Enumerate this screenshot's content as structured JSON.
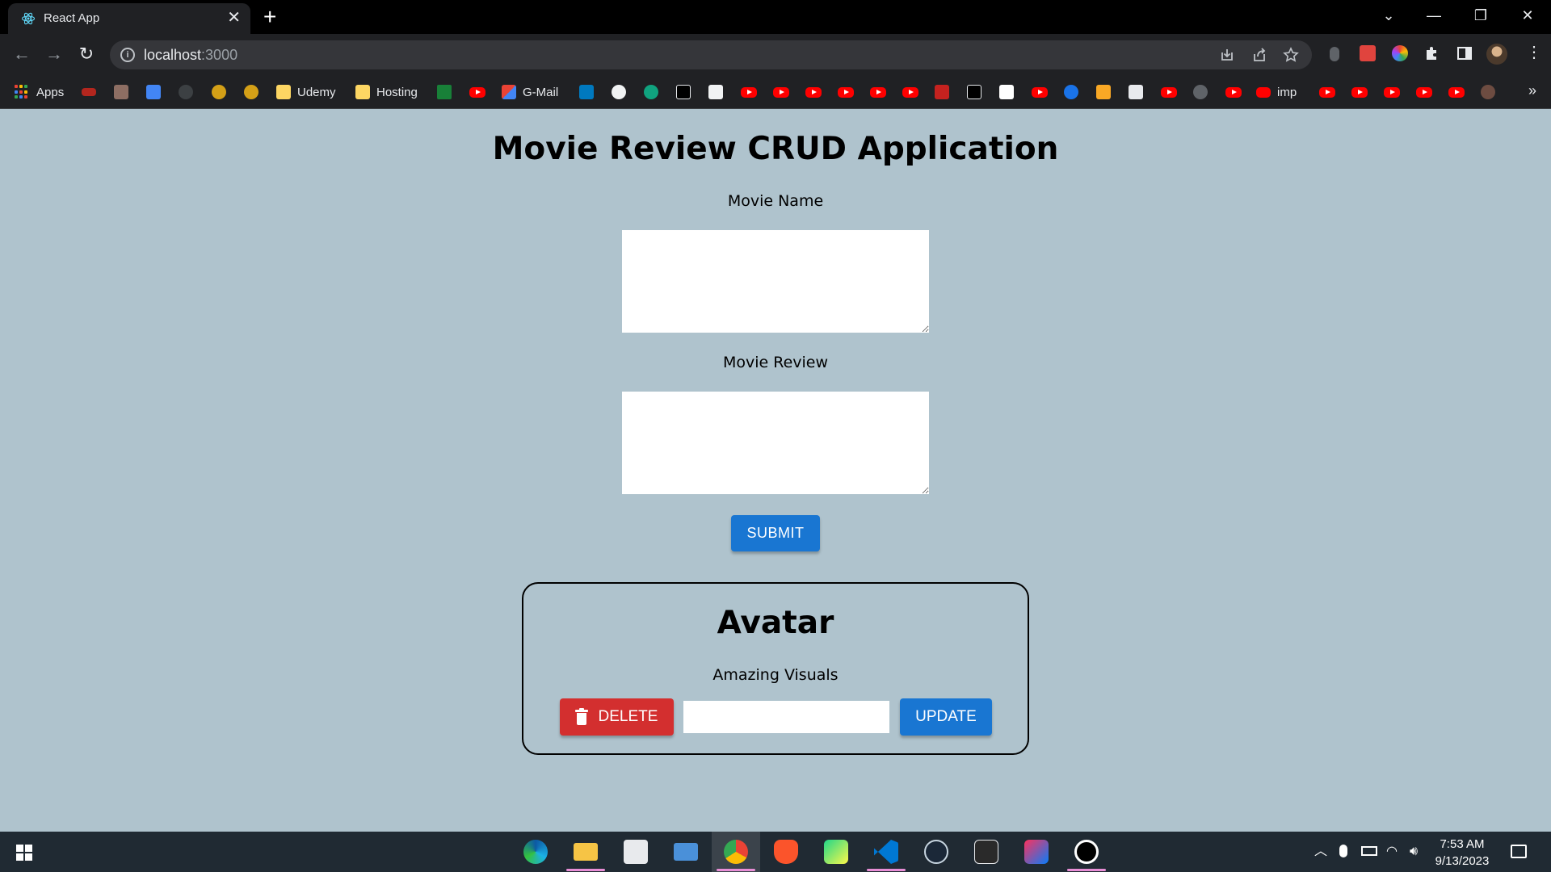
{
  "browser": {
    "tab_title": "React App",
    "tab_close": "✕",
    "new_tab": "+",
    "url_host": "localhost",
    "url_port": ":3000",
    "window_controls": {
      "tab_search": "⌄",
      "minimize": "—",
      "restore": "❐",
      "close": "✕"
    },
    "nav": {
      "back": "←",
      "forward": "→",
      "reload": "↻"
    }
  },
  "bookmarks": {
    "apps": "Apps",
    "udemy": "Udemy",
    "hosting": "Hosting",
    "gmail": "G-Mail",
    "imp": "imp",
    "more": "»"
  },
  "app": {
    "title": "Movie Review CRUD Application",
    "movie_name_label": "Movie Name",
    "movie_review_label": "Movie Review",
    "movie_name_value": "",
    "movie_review_value": "",
    "submit_label": "SUBMIT"
  },
  "reviews": [
    {
      "movie_name": "Avatar",
      "review": "Amazing Visuals",
      "delete_label": "DELETE",
      "update_label": "UPDATE",
      "update_value": ""
    }
  ],
  "taskbar": {
    "time": "7:53 AM",
    "date": "9/13/2023"
  },
  "colors": {
    "page_background": "#afc3cd",
    "primary": "#1976d2",
    "danger": "#d32f2f"
  }
}
